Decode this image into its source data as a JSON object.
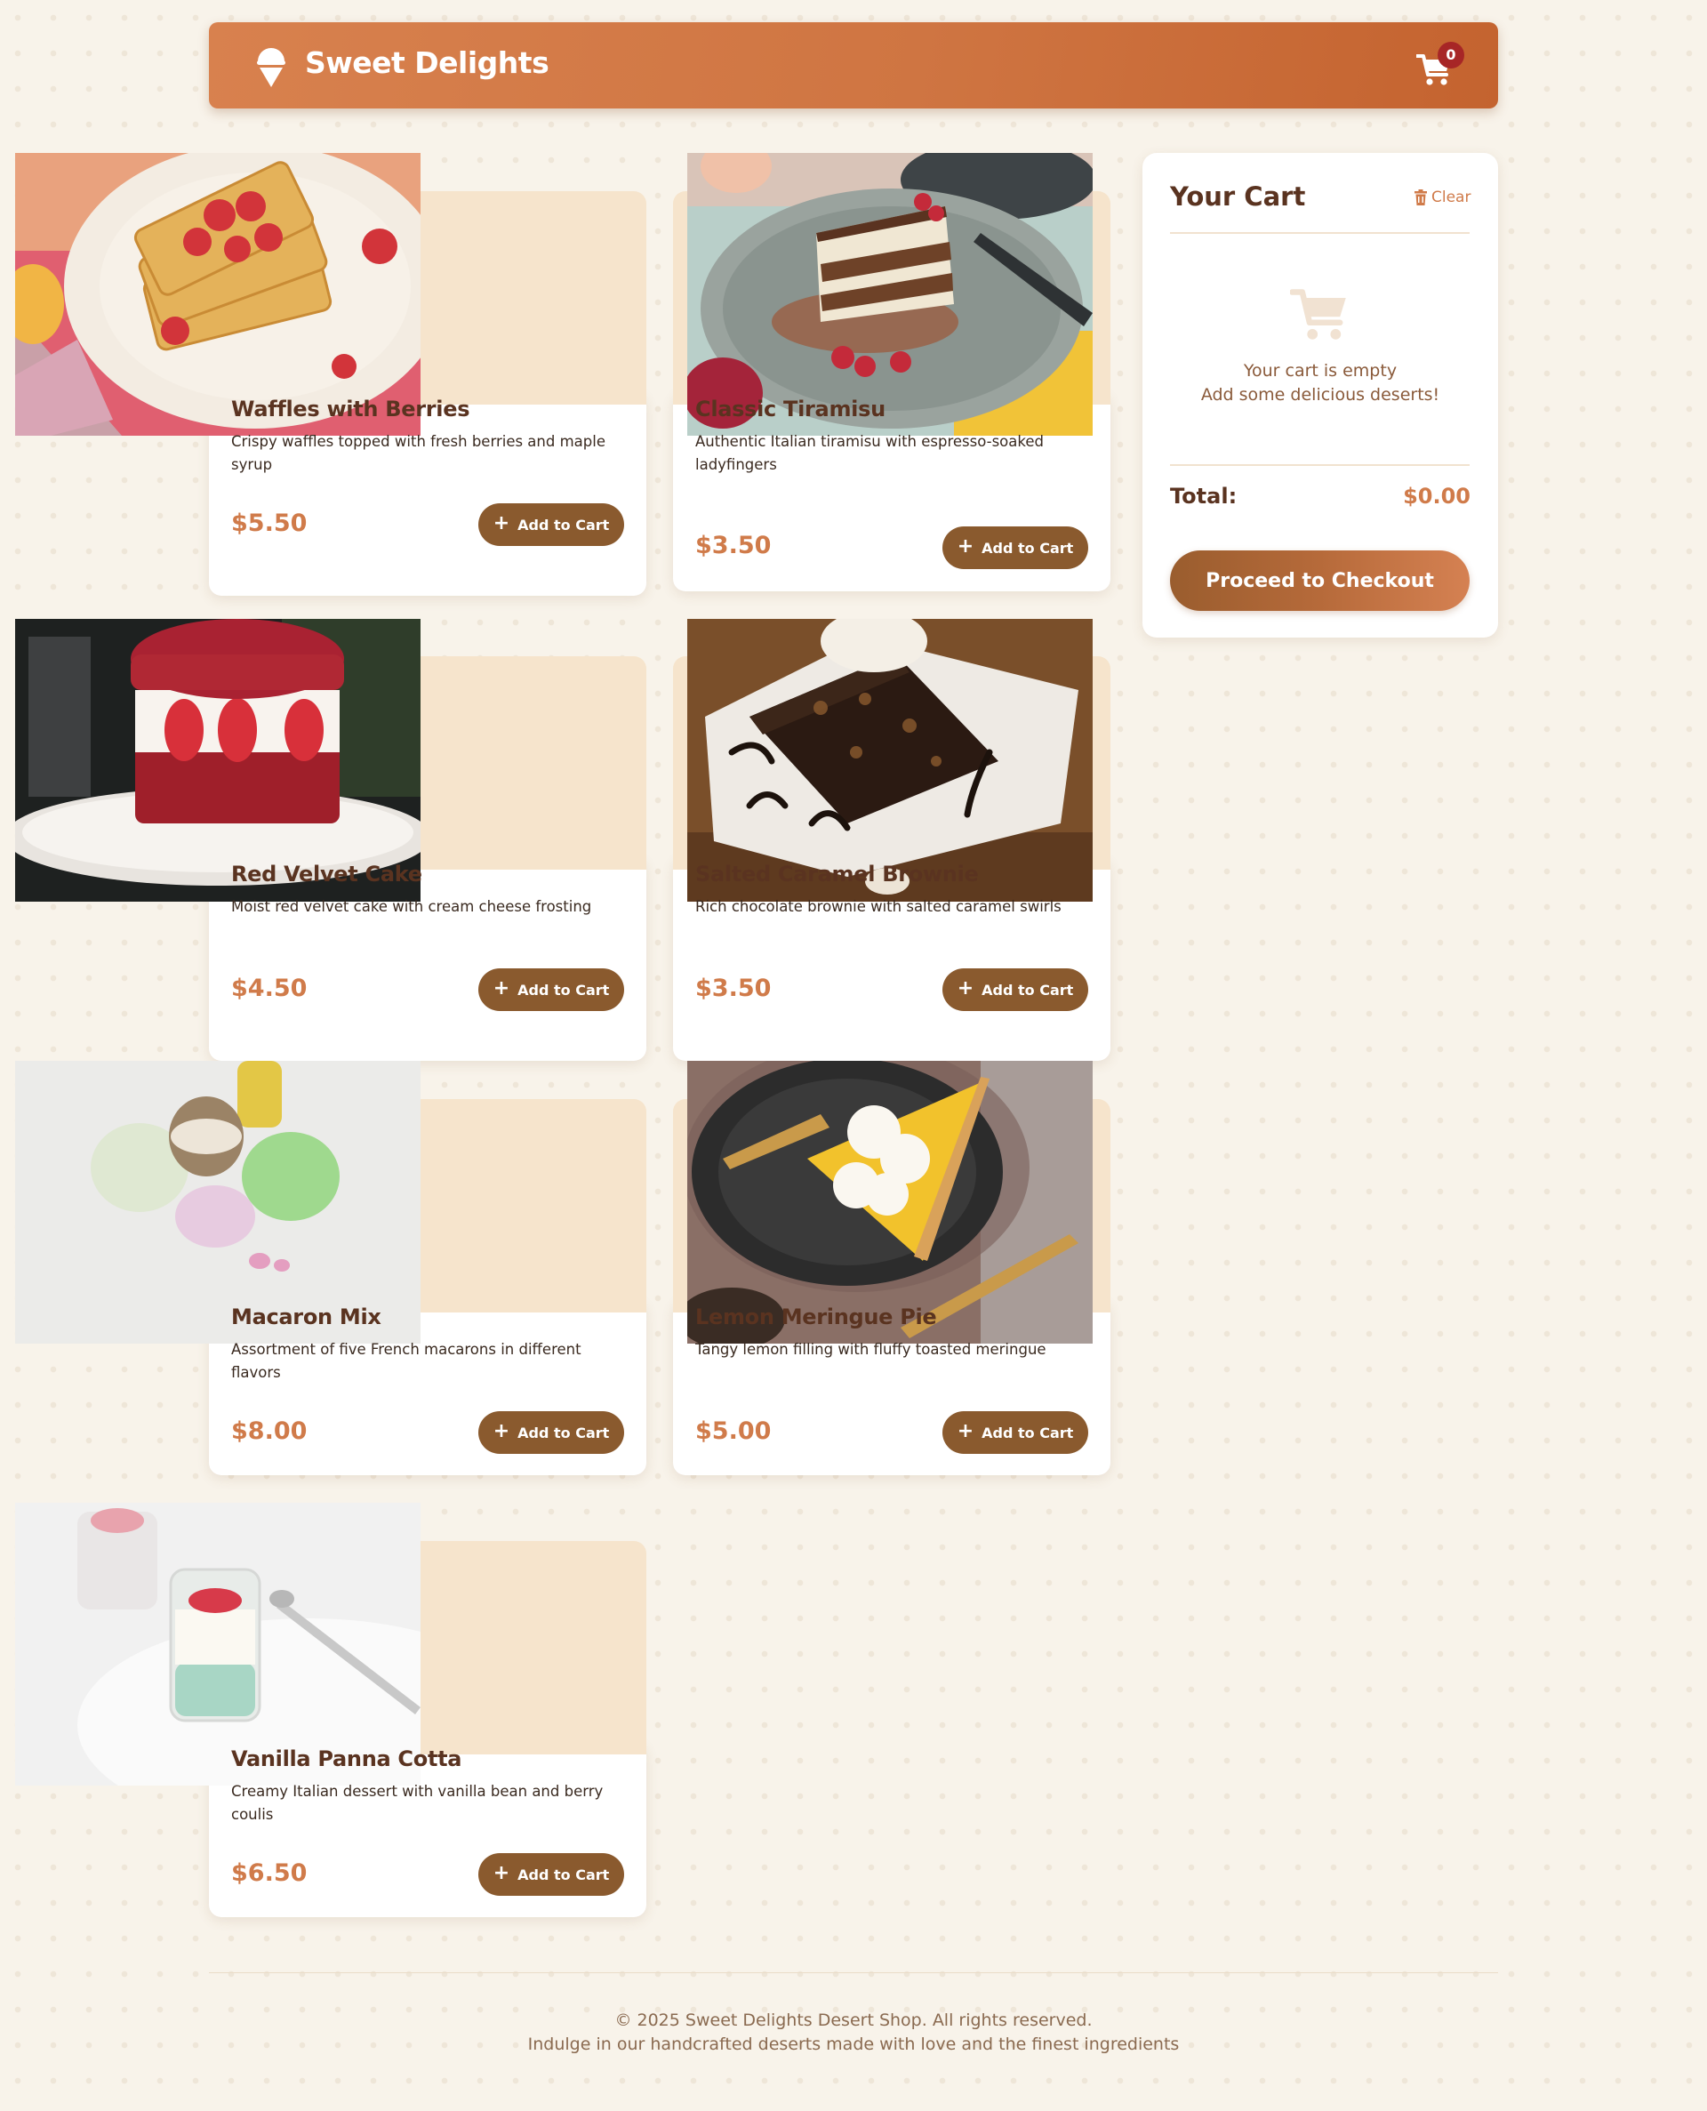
{
  "header": {
    "brand_name": "Sweet Delights",
    "brand_icon": "ice-cream-icon",
    "cart_icon": "cart-icon",
    "cart_count": "0"
  },
  "products": [
    {
      "name": "Waffles with Berries",
      "description": "Crispy waffles topped with fresh berries and maple syrup",
      "price": "$5.50",
      "button": "Add to Cart"
    },
    {
      "name": "Classic Tiramisu",
      "description": "Authentic Italian tiramisu with espresso-soaked ladyfingers",
      "price": "$3.50",
      "button": "Add to Cart"
    },
    {
      "name": "Red Velvet Cake",
      "description": "Moist red velvet cake with cream cheese frosting",
      "price": "$4.50",
      "button": "Add to Cart"
    },
    {
      "name": "Salted Caramel Brownie",
      "description": "Rich chocolate brownie with salted caramel swirls",
      "price": "$3.50",
      "button": "Add to Cart"
    },
    {
      "name": "Macaron Mix",
      "description": "Assortment of five French macarons in different flavors",
      "price": "$8.00",
      "button": "Add to Cart"
    },
    {
      "name": "Lemon Meringue Pie",
      "description": "Tangy lemon filling with fluffy toasted meringue",
      "price": "$5.00",
      "button": "Add to Cart"
    },
    {
      "name": "Vanilla Panna Cotta",
      "description": "Creamy Italian dessert with vanilla bean and berry coulis",
      "price": "$6.50",
      "button": "Add to Cart"
    }
  ],
  "cart": {
    "title": "Your Cart",
    "clear_label": "Clear",
    "empty_line1": "Your cart is empty",
    "empty_line2": "Add some delicious deserts!",
    "total_label": "Total:",
    "total_value": "$0.00",
    "checkout_label": "Proceed to Checkout"
  },
  "footer": {
    "copyright": "© 2025 Sweet Delights Desert Shop. All rights reserved.",
    "tagline": "Indulge in our handcrafted deserts made with love and the finest ingredients"
  },
  "colors": {
    "header": "#cf7542",
    "button": "#8a5a2e",
    "price": "#d07b4a",
    "badge": "#a72626",
    "text": "#5a3320"
  }
}
